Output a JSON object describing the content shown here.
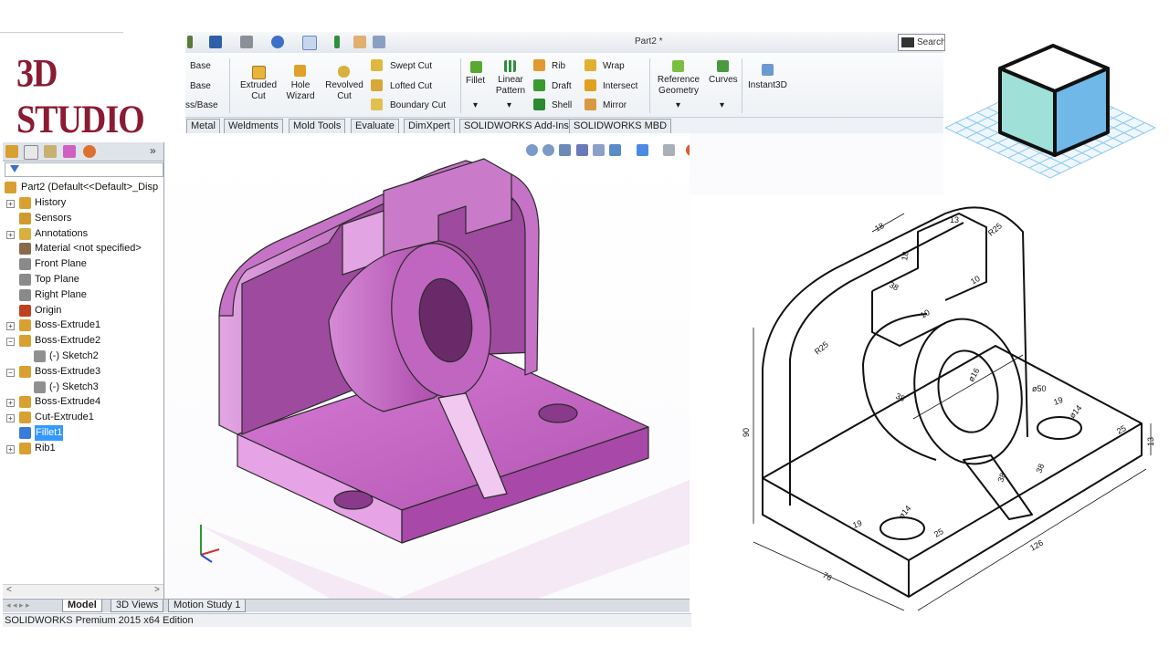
{
  "logo": {
    "text": "3D STUDIO"
  },
  "quick_access": {
    "title": "Part2 *",
    "search_placeholder": "Search"
  },
  "ribbon": {
    "partial": [
      "Base",
      "Base",
      "ss/Base"
    ],
    "extruded_cut": "Extruded Cut",
    "hole_wizard": "Hole Wizard",
    "revolved_cut": "Revolved Cut",
    "swept_cut": "Swept Cut",
    "lofted_cut": "Lofted Cut",
    "boundary_cut": "Boundary Cut",
    "fillet": "Fillet",
    "linear_pattern": "Linear Pattern",
    "rib": "Rib",
    "draft": "Draft",
    "shell": "Shell",
    "wrap": "Wrap",
    "intersect": "Intersect",
    "mirror": "Mirror",
    "reference_geometry": "Reference Geometry",
    "curves": "Curves",
    "instant3d": "Instant3D"
  },
  "command_tabs": [
    "Metal",
    "Weldments",
    "Mold Tools",
    "Evaluate",
    "DimXpert",
    "SOLIDWORKS Add-Ins",
    "SOLIDWORKS MBD"
  ],
  "tree": {
    "root": "Part2  (Default<<Default>_Disp",
    "items": [
      {
        "label": "History",
        "expander": "+"
      },
      {
        "label": "Sensors",
        "expander": ""
      },
      {
        "label": "Annotations",
        "expander": "+"
      },
      {
        "label": "Material <not specified>",
        "expander": ""
      },
      {
        "label": "Front Plane",
        "expander": ""
      },
      {
        "label": "Top Plane",
        "expander": ""
      },
      {
        "label": "Right Plane",
        "expander": ""
      },
      {
        "label": "Origin",
        "expander": ""
      },
      {
        "label": "Boss-Extrude1",
        "expander": "+"
      },
      {
        "label": "Boss-Extrude2",
        "expander": "−"
      },
      {
        "label": "(-) Sketch2",
        "expander": ""
      },
      {
        "label": "Boss-Extrude3",
        "expander": "−"
      },
      {
        "label": "(-) Sketch3",
        "expander": ""
      },
      {
        "label": "Boss-Extrude4",
        "expander": "+"
      },
      {
        "label": "Cut-Extrude1",
        "expander": "+"
      },
      {
        "label": "Fillet1",
        "expander": ""
      },
      {
        "label": "Rib1",
        "expander": "+"
      }
    ]
  },
  "bottom_tabs": [
    "Model",
    "3D Views",
    "Motion Study 1"
  ],
  "status_text": "SOLIDWORKS Premium 2015 x64 Edition",
  "scroll_arrows": {
    "left": "<",
    "right": ">"
  },
  "panel_more": "»",
  "drawing_dims": [
    "18",
    "13",
    "R25",
    "18",
    "38",
    "10",
    "10",
    "R25",
    "38",
    "ø16",
    "ø50",
    "19",
    "ø14",
    "25",
    "13",
    "90",
    "38",
    "38",
    "19",
    "ø14",
    "25",
    "126",
    "76"
  ],
  "colors": {
    "part": "#c063c0",
    "part_dark": "#8a3a8a",
    "part_light": "#e6a3e6",
    "selection": "#3399ff",
    "logo": "#8b1a33",
    "cube_left": "#9fe0d8",
    "cube_right": "#6fb8e8",
    "grid": "#8ec8ee"
  }
}
